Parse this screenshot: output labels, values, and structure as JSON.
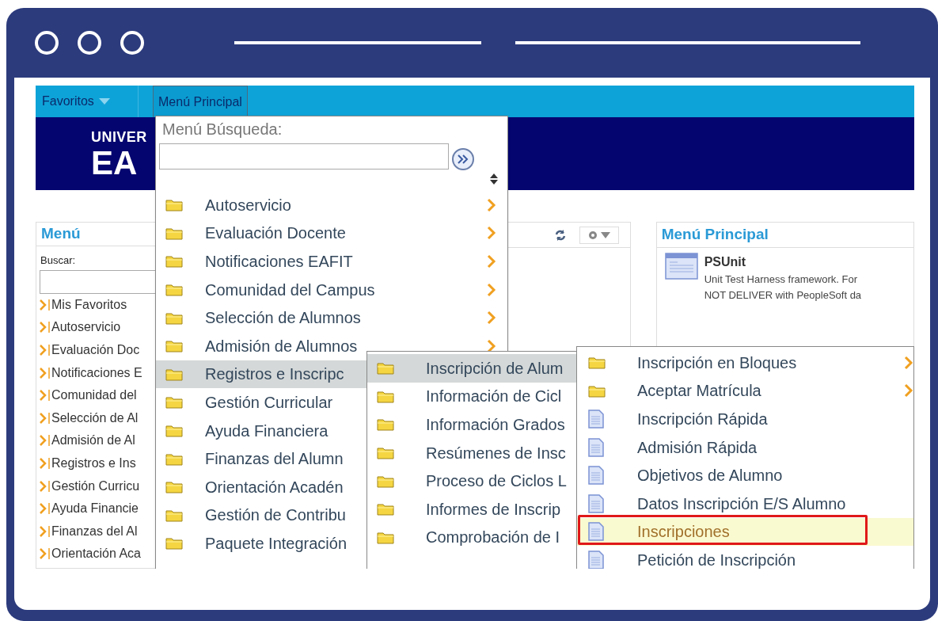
{
  "nav_bar": {
    "tabs": [
      {
        "label": "Favoritos",
        "selected": false,
        "caret": true
      },
      {
        "label": "Menú Principal",
        "selected": true,
        "caret": false
      }
    ]
  },
  "banner": {
    "logo_lines": [
      "UNIVER",
      "EA"
    ]
  },
  "menu_panel": {
    "title": "Menú",
    "search_label": "Buscar:",
    "items": [
      "Mis Favoritos",
      "Autoservicio",
      "Evaluación Doc",
      "Notificaciones E",
      "Comunidad del",
      "Selección de Al",
      "Admisión de Al",
      "Registros e Ins",
      "Gestión Curricu",
      "Ayuda Financie",
      "Finanzas del Al",
      "Orientación Aca"
    ]
  },
  "main_menu_panel": {
    "title": "Menú Principal",
    "items": [
      {
        "title": "PSUnit",
        "lines": [
          "Unit Test Harness framework. For",
          "NOT DELIVER with PeopleSoft da"
        ]
      }
    ]
  },
  "dropdown": {
    "search_label": "Menú Búsqueda:",
    "items": [
      {
        "label": "Autoservicio",
        "kind": "folder",
        "selected": false,
        "arrow": true
      },
      {
        "label": "Evaluación Docente",
        "kind": "folder",
        "selected": false,
        "arrow": true
      },
      {
        "label": "Notificaciones EAFIT",
        "kind": "folder",
        "selected": false,
        "arrow": true
      },
      {
        "label": "Comunidad del Campus",
        "kind": "folder",
        "selected": false,
        "arrow": true
      },
      {
        "label": "Selección de Alumnos",
        "kind": "folder",
        "selected": false,
        "arrow": true
      },
      {
        "label": "Admisión de Alumnos",
        "kind": "folder",
        "selected": false,
        "arrow": true
      },
      {
        "label": "Registros e Inscripc",
        "kind": "folder",
        "selected": true
      },
      {
        "label": "Gestión Curricular",
        "kind": "folder",
        "selected": false
      },
      {
        "label": "Ayuda Financiera",
        "kind": "folder",
        "selected": false
      },
      {
        "label": "Finanzas del Alumn",
        "kind": "folder",
        "selected": false
      },
      {
        "label": "Orientación Acadén",
        "kind": "folder",
        "selected": false
      },
      {
        "label": "Gestión de Contribu",
        "kind": "folder",
        "selected": false
      },
      {
        "label": "Paquete Integración",
        "kind": "folder",
        "selected": false
      }
    ]
  },
  "submenu": {
    "items": [
      {
        "label": "Inscripción de Alum",
        "kind": "folder",
        "selected": true
      },
      {
        "label": "Información de Cicl",
        "kind": "folder",
        "selected": false
      },
      {
        "label": "Información Grados",
        "kind": "folder",
        "selected": false
      },
      {
        "label": "Resúmenes de Insc",
        "kind": "folder",
        "selected": false
      },
      {
        "label": "Proceso de Ciclos L",
        "kind": "folder",
        "selected": false
      },
      {
        "label": "Informes de Inscrip",
        "kind": "folder",
        "selected": false
      },
      {
        "label": "Comprobación de I",
        "kind": "folder",
        "selected": false
      }
    ]
  },
  "submenu_2": {
    "items": [
      {
        "label": "Inscripción en Bloques",
        "kind": "folder",
        "selected": false,
        "arrow": true,
        "outlined": false
      },
      {
        "label": "Aceptar Matrícula",
        "kind": "folder",
        "selected": false,
        "arrow": true,
        "outlined": false
      },
      {
        "label": "Inscripción Rápida",
        "kind": "page",
        "selected": false,
        "arrow": false,
        "outlined": false
      },
      {
        "label": "Admisión Rápida",
        "kind": "page",
        "selected": false,
        "arrow": false,
        "outlined": false
      },
      {
        "label": "Objetivos de Alumno",
        "kind": "page",
        "selected": false,
        "arrow": false,
        "outlined": false
      },
      {
        "label": "Datos Inscripción E/S Alumno",
        "kind": "page",
        "selected": false,
        "arrow": false,
        "outlined": false
      },
      {
        "label": "Inscripciones",
        "kind": "page",
        "selected": true,
        "arrow": false,
        "outlined": true
      },
      {
        "label": "Petición de Inscripción",
        "kind": "page",
        "selected": false,
        "arrow": false,
        "outlined": false
      }
    ]
  }
}
